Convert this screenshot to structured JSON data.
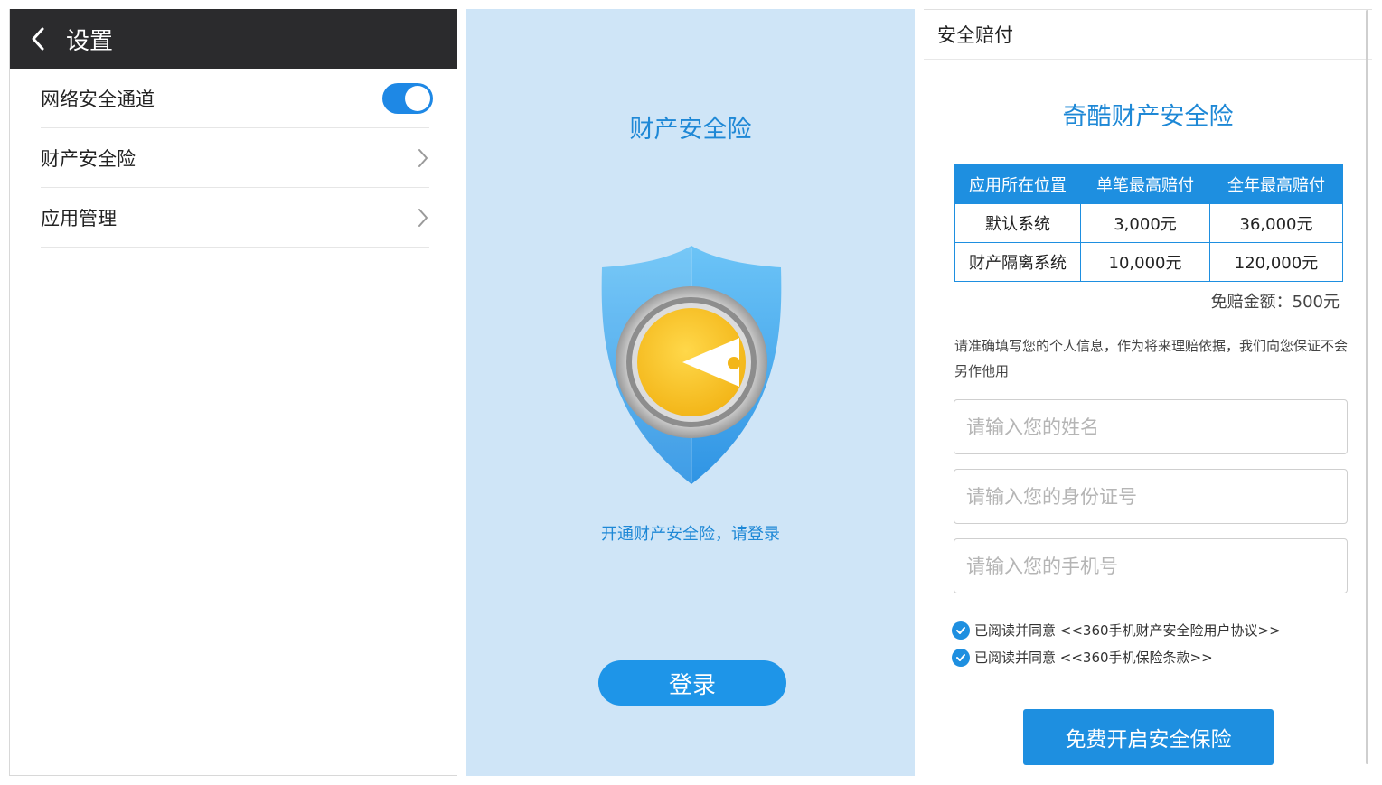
{
  "settings": {
    "title": "设置",
    "items": [
      {
        "label": "网络安全通道",
        "control": "toggle",
        "on": true
      },
      {
        "label": "财产安全险",
        "control": "chevron"
      },
      {
        "label": "应用管理",
        "control": "chevron"
      }
    ]
  },
  "login": {
    "title": "财产安全险",
    "hint": "开通财产安全险，请登录",
    "button_label": "登录"
  },
  "claim": {
    "header_title": "安全赔付",
    "title": "奇酷财产安全险",
    "table": {
      "headers": [
        "应用所在位置",
        "单笔最高赔付",
        "全年最高赔付"
      ],
      "rows": [
        [
          "默认系统",
          "3,000元",
          "36,000元"
        ],
        [
          "财产隔离系统",
          "10,000元",
          "120,000元"
        ]
      ]
    },
    "deductible": "免赔金额：500元",
    "privacy_note": "请准确填写您的个人信息，作为将来理赔依据，我们向您保证不会另作他用",
    "inputs": {
      "name_placeholder": "请输入您的姓名",
      "id_placeholder": "请输入您的身份证号",
      "phone_placeholder": "请输入您的手机号"
    },
    "agreements": [
      {
        "text": "已阅读并同意 <<360手机财产安全险用户协议>>",
        "checked": true
      },
      {
        "text": "已阅读并同意 <<360手机保险条款>>",
        "checked": true
      }
    ],
    "submit_label": "免费开启安全保险"
  },
  "colors": {
    "accent": "#1e8fe0",
    "header_dark": "#2b2b2d",
    "login_bg": "#cfe5f7",
    "title_blue": "#1e88d6"
  }
}
